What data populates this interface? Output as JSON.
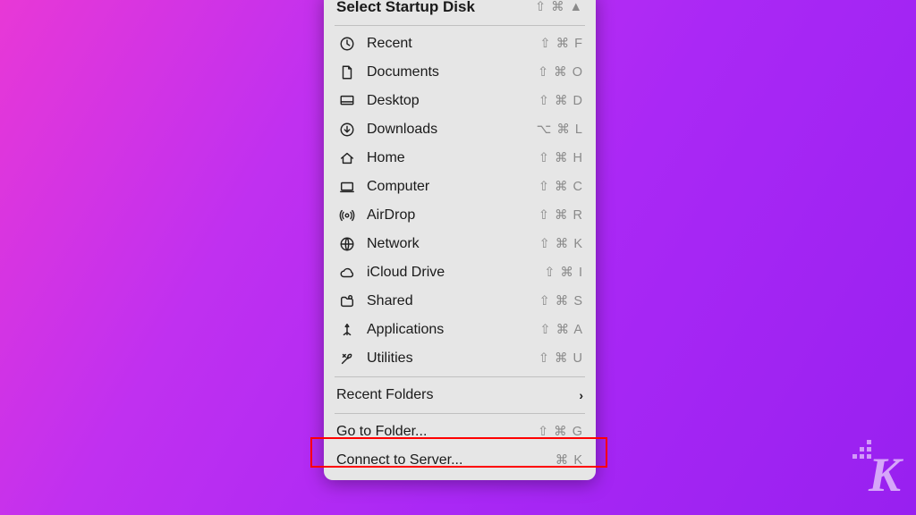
{
  "menu": {
    "selectStartup": {
      "label": "Select Startup Disk",
      "shortcut": "⇧ ⌘ ▲"
    },
    "items": [
      {
        "icon": "clock-icon",
        "label": "Recent",
        "shortcut": "⇧ ⌘ F"
      },
      {
        "icon": "document-icon",
        "label": "Documents",
        "shortcut": "⇧ ⌘ O"
      },
      {
        "icon": "desktop-icon",
        "label": "Desktop",
        "shortcut": "⇧ ⌘ D"
      },
      {
        "icon": "download-icon",
        "label": "Downloads",
        "shortcut": "⌥ ⌘ L"
      },
      {
        "icon": "home-icon",
        "label": "Home",
        "shortcut": "⇧ ⌘ H"
      },
      {
        "icon": "computer-icon",
        "label": "Computer",
        "shortcut": "⇧ ⌘ C"
      },
      {
        "icon": "airdrop-icon",
        "label": "AirDrop",
        "shortcut": "⇧ ⌘ R"
      },
      {
        "icon": "network-icon",
        "label": "Network",
        "shortcut": "⇧ ⌘ K"
      },
      {
        "icon": "cloud-icon",
        "label": "iCloud Drive",
        "shortcut": "⇧ ⌘ I"
      },
      {
        "icon": "shared-icon",
        "label": "Shared",
        "shortcut": "⇧ ⌘ S"
      },
      {
        "icon": "apps-icon",
        "label": "Applications",
        "shortcut": "⇧ ⌘ A"
      },
      {
        "icon": "utilities-icon",
        "label": "Utilities",
        "shortcut": "⇧ ⌘ U"
      }
    ],
    "recentFolders": {
      "label": "Recent Folders",
      "chevron": "›"
    },
    "goToFolder": {
      "label": "Go to Folder...",
      "shortcut": "⇧ ⌘ G"
    },
    "connect": {
      "label": "Connect to Server...",
      "shortcut": "⌘ K"
    }
  },
  "watermark": {
    "letter": "K"
  }
}
